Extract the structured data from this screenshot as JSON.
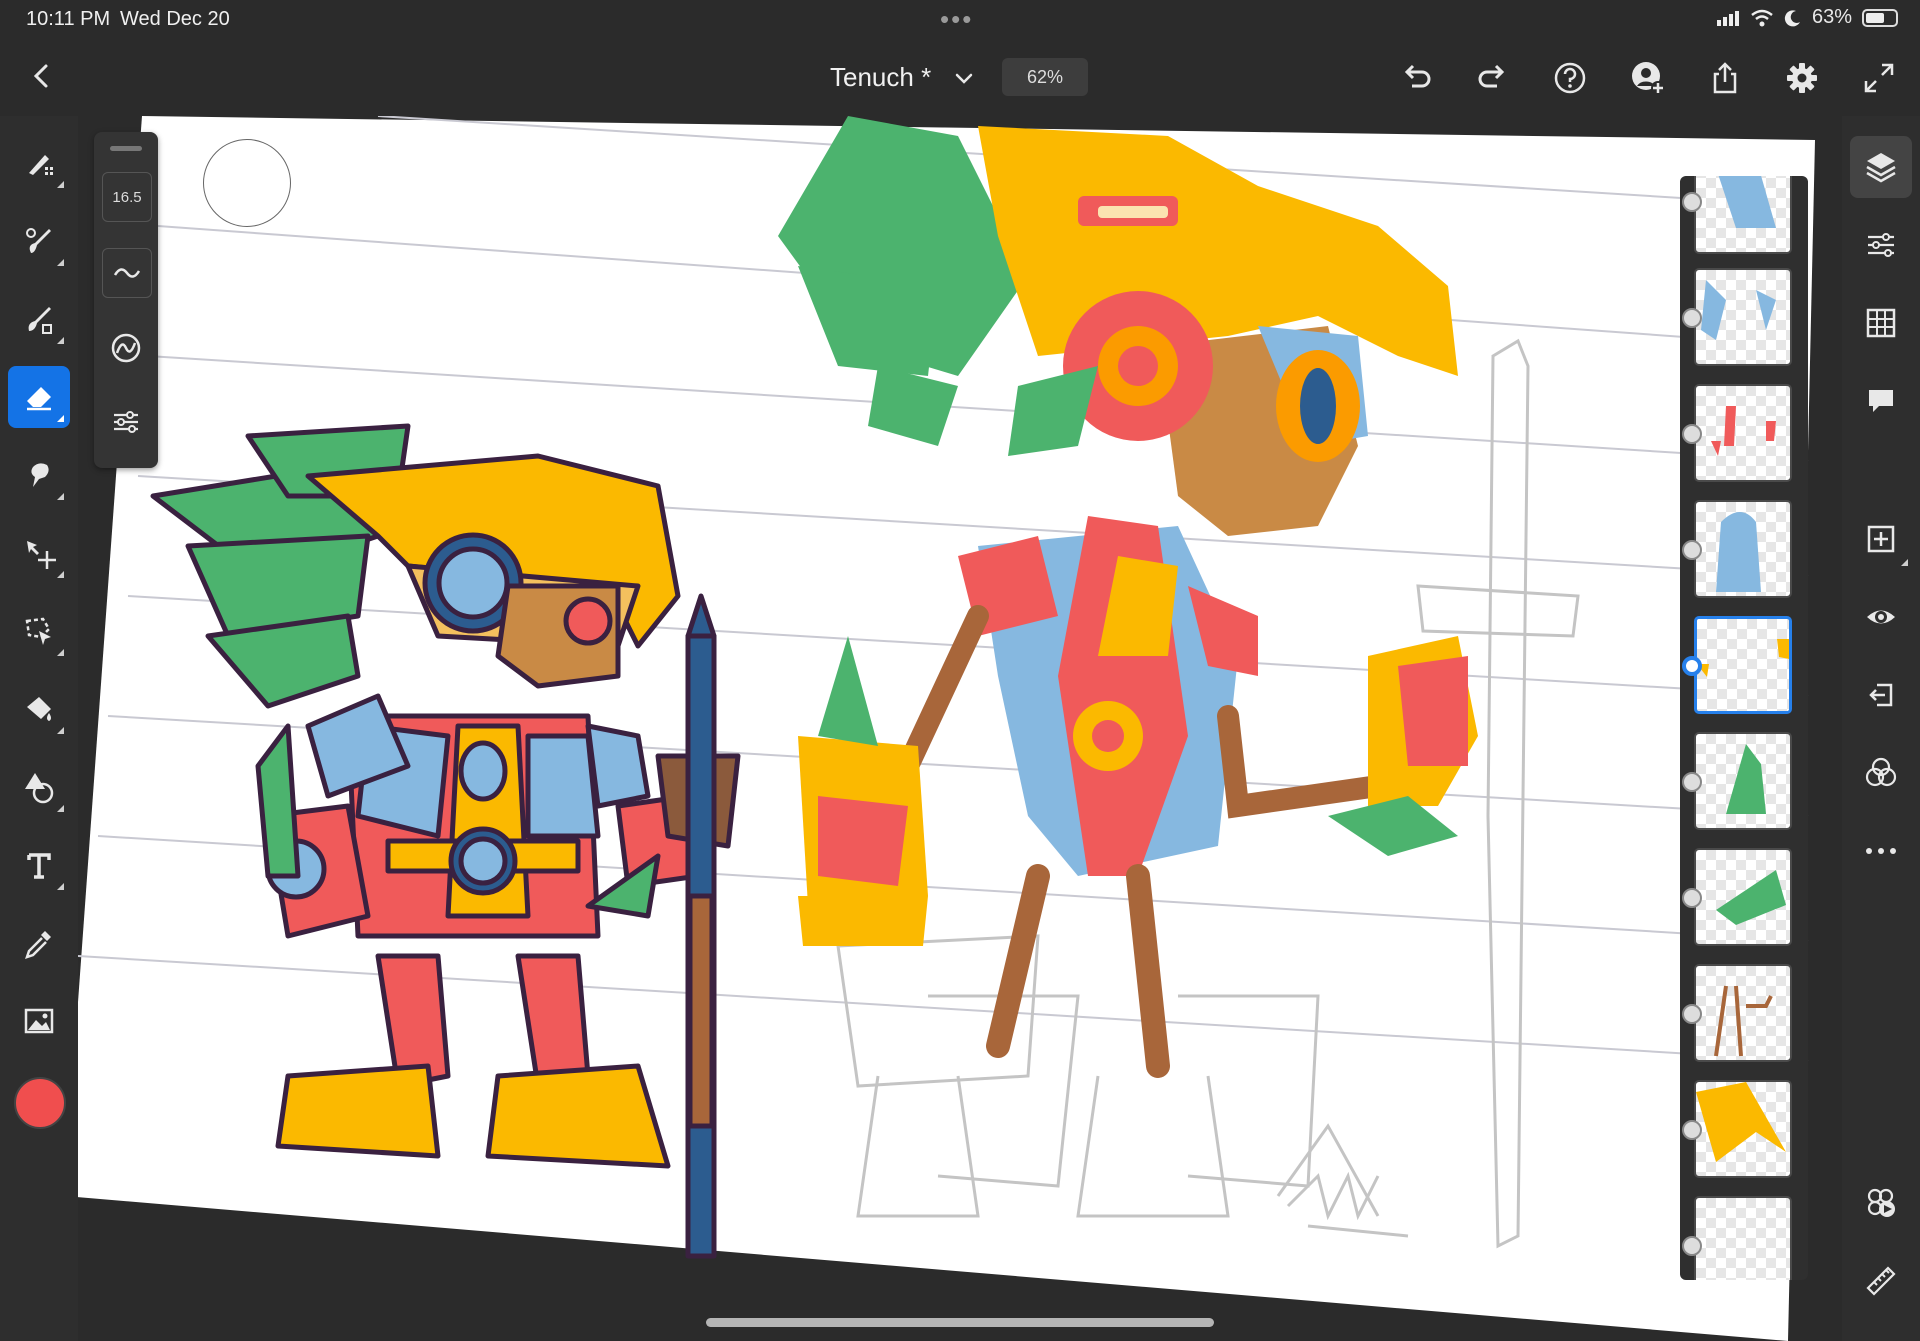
{
  "status": {
    "time": "10:11 PM",
    "date": "Wed Dec 20",
    "battery": "63%",
    "battery_level": 0.63
  },
  "toolbar": {
    "title": "Tenuch *",
    "zoom": "62%",
    "icons": [
      "back-icon",
      "undo-icon",
      "redo-icon",
      "help-icon",
      "invite-icon",
      "share-icon",
      "settings-icon",
      "fullscreen-icon"
    ]
  },
  "brush_panel": {
    "size": "16.5"
  },
  "left_tools": [
    "pixel-brush",
    "live-brush",
    "vector-brush",
    "eraser",
    "smudge",
    "move-transform",
    "selection",
    "fill",
    "shapes",
    "text",
    "eyedropper",
    "image"
  ],
  "active_tool": "eraser",
  "current_color": "#f04e4e",
  "right_tools": [
    "layers",
    "layer-properties",
    "grid",
    "comments",
    "add-layer",
    "visibility",
    "import",
    "blend-mode",
    "more",
    "livestream",
    "ruler"
  ],
  "layers": {
    "count": 10,
    "selected_index": 4
  },
  "colors": {
    "accent": "#1473e6",
    "red": "#f05a5a",
    "yellow": "#fbb900",
    "green": "#4cb36e",
    "blue": "#86b8e0",
    "brown": "#a8663a"
  }
}
